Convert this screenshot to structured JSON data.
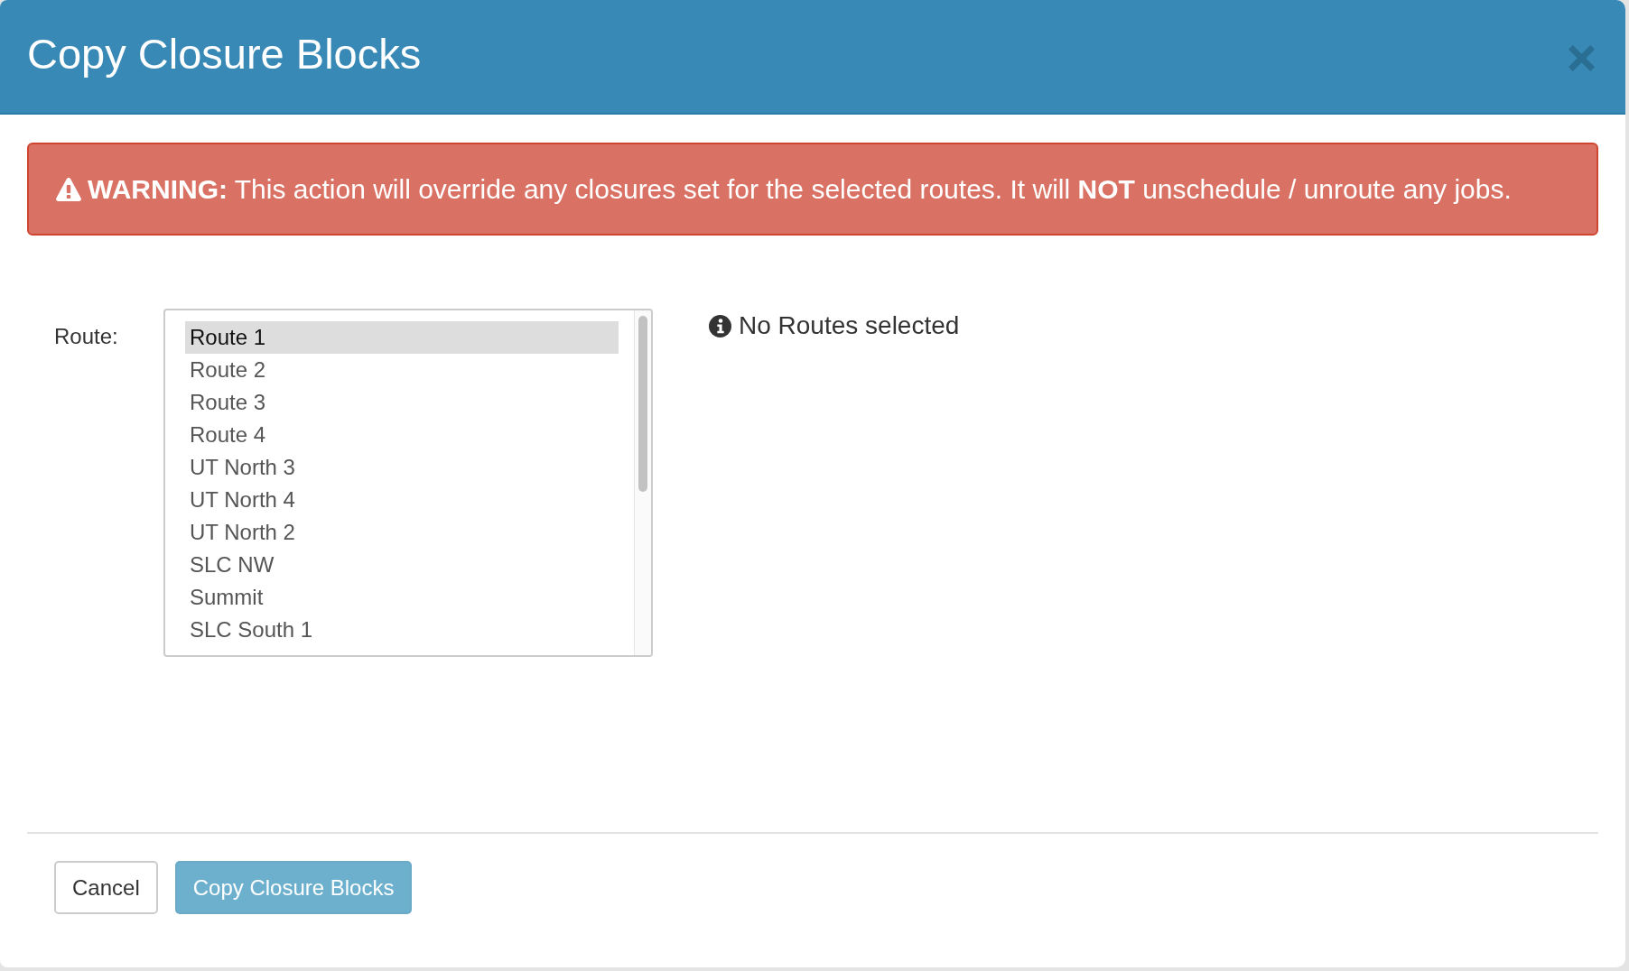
{
  "dialog": {
    "title": "Copy Closure Blocks"
  },
  "warning": {
    "text": "**WARNING:** This action will override any closures set for the selected routes. It will **NOT** unschedule / unroute any jobs."
  },
  "route_field": {
    "label": "Route:",
    "options": [
      {
        "label": "Route 1",
        "highlighted": true
      },
      {
        "label": "Route 2",
        "highlighted": false
      },
      {
        "label": "Route 3",
        "highlighted": false
      },
      {
        "label": "Route 4",
        "highlighted": false
      },
      {
        "label": "UT North 3",
        "highlighted": false
      },
      {
        "label": "UT North 4",
        "highlighted": false
      },
      {
        "label": "UT North 2",
        "highlighted": false
      },
      {
        "label": "SLC NW",
        "highlighted": false
      },
      {
        "label": "Summit",
        "highlighted": false
      },
      {
        "label": "SLC South 1",
        "highlighted": false
      }
    ]
  },
  "selection_status": {
    "text": "No Routes selected"
  },
  "buttons": [
    {
      "label": "Cancel",
      "kind": "default",
      "disabled": false
    },
    {
      "label": "Copy Closure Blocks",
      "kind": "primary",
      "disabled": true
    }
  ]
}
